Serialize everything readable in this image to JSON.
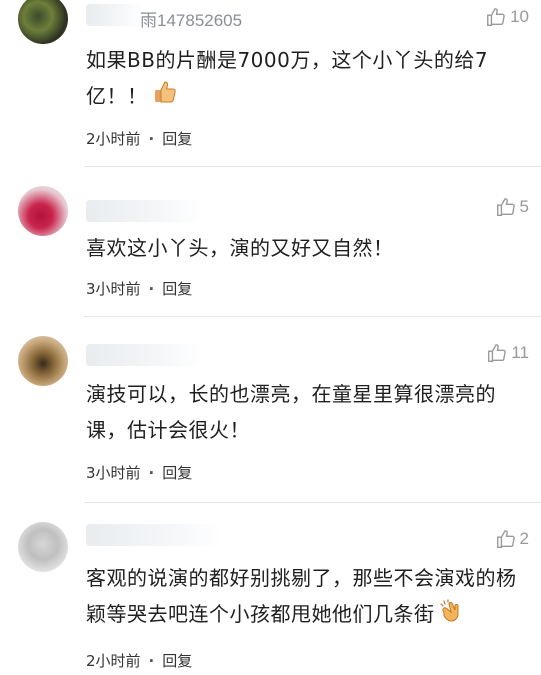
{
  "comments": [
    {
      "username": "雨147852605",
      "likes": "10",
      "text": "如果BB的片酬是7000万，这个小丫头的给7亿！！",
      "emoji": "thumbs-up-icon",
      "time": "2小时前",
      "separator": "·",
      "reply": "回复"
    },
    {
      "username": "",
      "likes": "5",
      "text": "喜欢这小丫头，演的又好又自然！",
      "time": "3小时前",
      "separator": "·",
      "reply": "回复"
    },
    {
      "username": "",
      "likes": "11",
      "text": "演技可以，长的也漂亮，在童星里算很漂亮的课，估计会很火！",
      "time": "3小时前",
      "separator": "·",
      "reply": "回复"
    },
    {
      "username": "",
      "likes": "2",
      "text": "客观的说演的都好别挑剔了，那些不会演戏的杨颖等哭去吧连个小孩都甩她他们几条街",
      "emoji": "clapping-hands-icon",
      "time": "2小时前",
      "separator": "·",
      "reply": "回复"
    }
  ],
  "colors": {
    "like_gray": "#999999",
    "text": "#1f1f1f",
    "divider": "#e6e6e6"
  }
}
